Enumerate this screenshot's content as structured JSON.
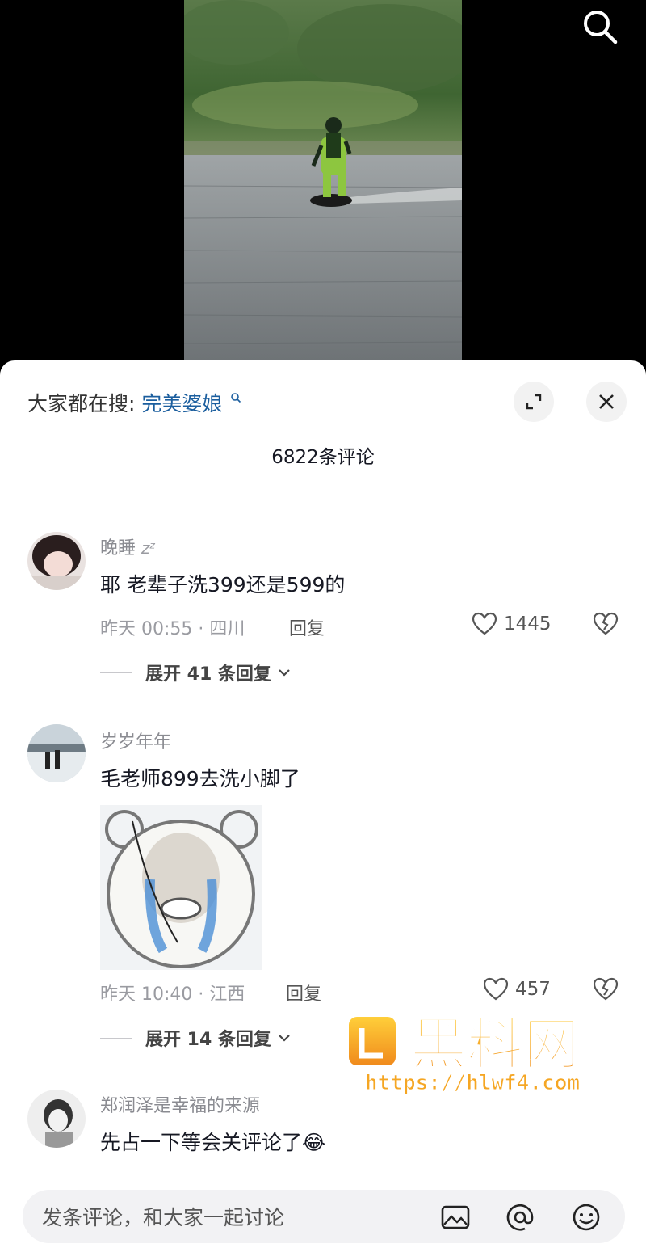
{
  "header": {
    "hot_search_prefix": "大家都在搜:",
    "hot_search_term": "完美婆娘",
    "hot_search_icon": "search-small-icon"
  },
  "comment_count_label": "6822条评论",
  "comments": [
    {
      "username": "晚睡",
      "username_suffix": "zᶻ",
      "text": "耶 老辈子洗399还是599的",
      "time_location": "昨天 00:55 · 四川",
      "reply_label": "回复",
      "likes": "1445",
      "expand_label": "展开 41 条回复"
    },
    {
      "username": "岁岁年年",
      "text": "毛老师899去洗小脚了",
      "has_sticker": true,
      "time_location": "昨天 10:40 · 江西",
      "reply_label": "回复",
      "likes": "457",
      "expand_label": "展开 14 条回复"
    },
    {
      "username": "郑润泽是幸福的来源",
      "text": "先占一下等会关评论了",
      "emoji": "😂"
    }
  ],
  "input": {
    "placeholder": "发条评论，和大家一起讨论"
  },
  "watermark": {
    "title": "黑料网",
    "url": "https://hlwf4.com"
  },
  "colors": {
    "link": "#1b5e9e",
    "watermark_orange": "#f5a623"
  }
}
